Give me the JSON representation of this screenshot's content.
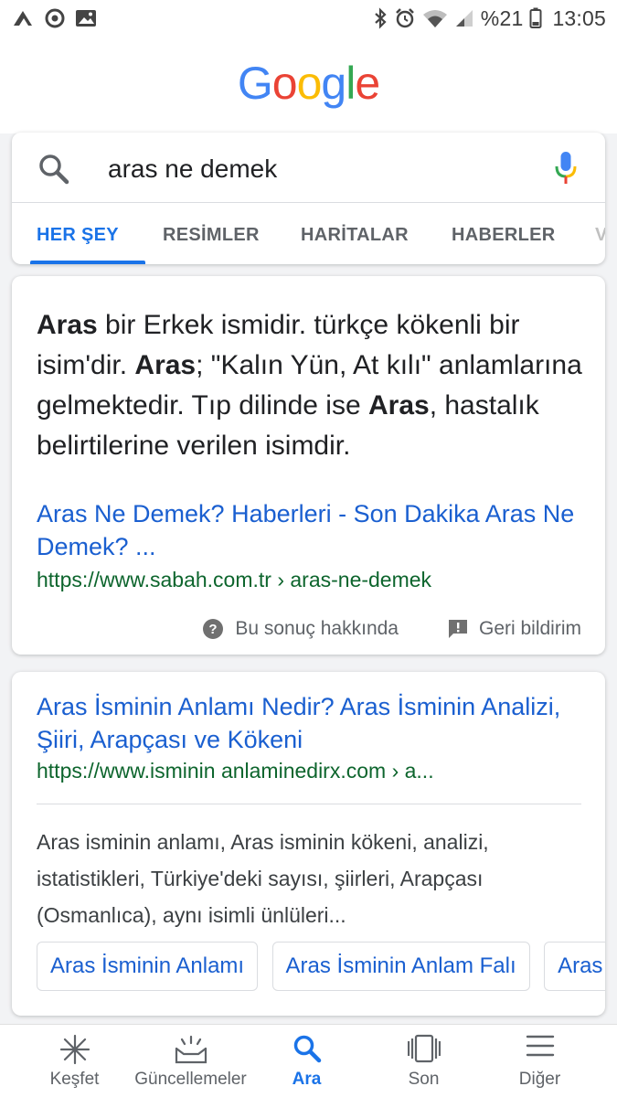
{
  "status_bar": {
    "battery": "%21",
    "time": "13:05"
  },
  "logo": {
    "letters": [
      "G",
      "o",
      "o",
      "g",
      "l",
      "e"
    ],
    "colors": [
      "#4285f4",
      "#ea4335",
      "#fbbc05",
      "#4285f4",
      "#34a853",
      "#ea4335"
    ]
  },
  "search": {
    "query": "aras ne demek"
  },
  "tabs": [
    {
      "label": "HER ŞEY",
      "active": true
    },
    {
      "label": "RESİMLER"
    },
    {
      "label": "HARİTALAR"
    },
    {
      "label": "HABERLER"
    },
    {
      "label": "V"
    }
  ],
  "featured": {
    "snippet": [
      {
        "t": "Aras",
        "b": true
      },
      {
        "t": " bir Erkek ismidir. türkçe kökenli bir isim'dir. "
      },
      {
        "t": "Aras",
        "b": true
      },
      {
        "t": "; \"Kalın Yün, At kılı\" anlamlarına gelmektedir. Tıp dilinde ise "
      },
      {
        "t": "Aras",
        "b": true
      },
      {
        "t": ", hastalık belirtilerine verilen isimdir."
      }
    ],
    "title": "Aras Ne Demek? Haberleri - Son Dakika Aras Ne Demek? ...",
    "url": "https://www.sabah.com.tr › aras-ne-demek",
    "about_label": "Bu sonuç hakkında",
    "feedback_label": "Geri bildirim"
  },
  "result2": {
    "title": "Aras İsminin Anlamı Nedir? Aras İsminin Analizi, Şiiri, Arapçası ve Kökeni",
    "url": "https://www.isminin anlaminedirx.com › a...",
    "description": "Aras isminin anlamı, Aras isminin kökeni, analizi, istatistikleri, Türkiye'deki sayısı, şiirleri, Arapçası (Osmanlıca), aynı isimli ünlüleri...",
    "chips": [
      "Aras İsminin Anlamı",
      "Aras İsminin Anlam Falı",
      "Aras"
    ]
  },
  "bottom_nav": [
    {
      "label": "Keşfet",
      "icon": "asterisk-icon"
    },
    {
      "label": "Güncellemeler",
      "icon": "updates-tray-icon"
    },
    {
      "label": "Ara",
      "icon": "search-icon",
      "active": true
    },
    {
      "label": "Son",
      "icon": "recent-cards-icon"
    },
    {
      "label": "Diğer",
      "icon": "menu-icon"
    }
  ],
  "colors": {
    "accent": "#1a73e8",
    "link": "#1a5fd0",
    "url_green": "#0d652d"
  }
}
